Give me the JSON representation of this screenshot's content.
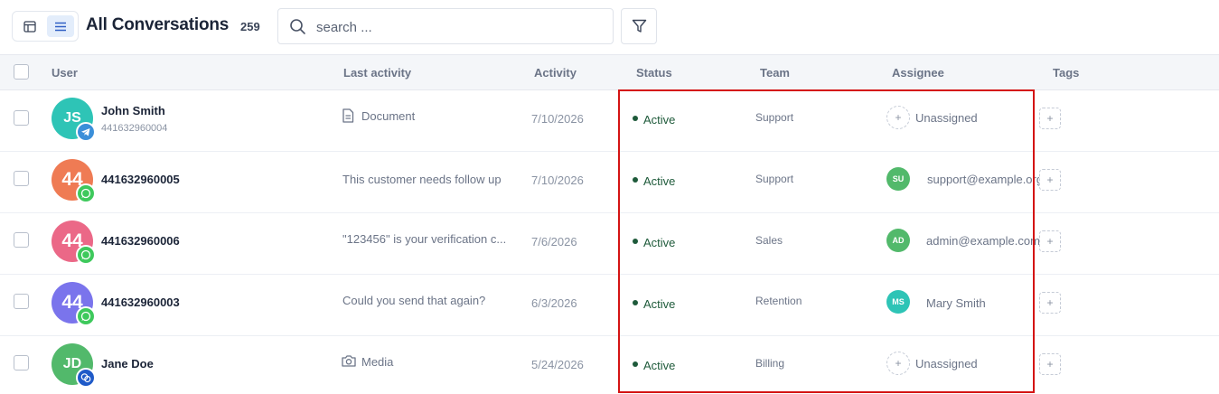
{
  "header": {
    "title": "All Conversations",
    "count": "259",
    "search_placeholder": "search ..."
  },
  "table": {
    "columns": {
      "user": "User",
      "last_activity": "Last activity",
      "activity": "Activity",
      "status": "Status",
      "team": "Team",
      "assignee": "Assignee",
      "tags": "Tags"
    },
    "rows": [
      {
        "initials": "JS",
        "avatar_color": "#2ec4b6",
        "channel": "telegram-icon",
        "channel_color": "#3b8fd9",
        "name": "John Smith",
        "phone": "441632960004",
        "last_icon": "document-icon",
        "last_activity": "Document",
        "activity": "7/10/2026",
        "status": "Active",
        "team": "Support",
        "assignee_initials": "+",
        "assignee_color": "",
        "assignee": "Unassigned"
      },
      {
        "initials": "44",
        "avatar_color": "#ef7b54",
        "channel": "whatsapp-icon",
        "channel_color": "#3ec95c",
        "name": "441632960005",
        "phone": "",
        "last_icon": "",
        "last_activity": "This customer needs follow up",
        "activity": "7/10/2026",
        "status": "Active",
        "team": "Support",
        "assignee_initials": "SU",
        "assignee_color": "#52b96b",
        "assignee": "support@example.org"
      },
      {
        "initials": "44",
        "avatar_color": "#eb6887",
        "channel": "whatsapp-icon",
        "channel_color": "#3ec95c",
        "name": "441632960006",
        "phone": "",
        "last_icon": "",
        "last_activity": "\"123456\" is your verification c...",
        "activity": "7/6/2026",
        "status": "Active",
        "team": "Sales",
        "assignee_initials": "AD",
        "assignee_color": "#52b96b",
        "assignee": "admin@example.com"
      },
      {
        "initials": "44",
        "avatar_color": "#7a74ec",
        "channel": "whatsapp-icon",
        "channel_color": "#3ec95c",
        "name": "441632960003",
        "phone": "",
        "last_icon": "",
        "last_activity": "Could you send that again?",
        "activity": "6/3/2026",
        "status": "Active",
        "team": "Retention",
        "assignee_initials": "MS",
        "assignee_color": "#2ec4b6",
        "assignee": "Mary Smith"
      },
      {
        "initials": "JD",
        "avatar_color": "#52b96b",
        "channel": "chat-bubbles-icon",
        "channel_color": "#1f5ac8",
        "name": "Jane Doe",
        "phone": "",
        "last_icon": "camera-icon",
        "last_activity": "Media",
        "activity": "5/24/2026",
        "status": "Active",
        "team": "Billing",
        "assignee_initials": "+",
        "assignee_color": "",
        "assignee": "Unassigned"
      }
    ],
    "tag_add_label": "+"
  },
  "colors": {
    "status_active": "#1e5a3a",
    "highlight_box": "#d41414",
    "accent": "#e3edfb"
  }
}
